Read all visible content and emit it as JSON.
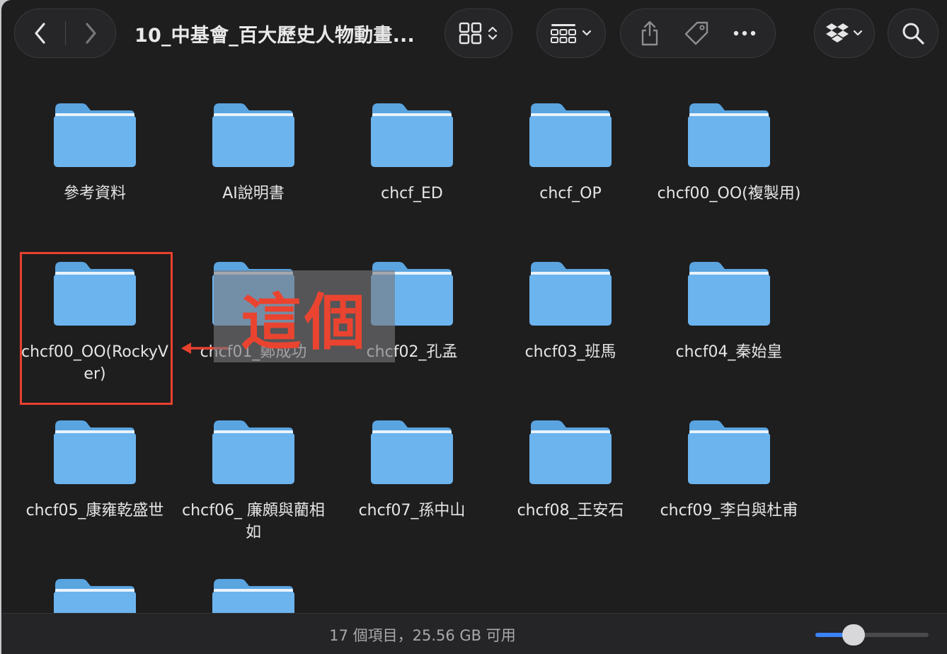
{
  "window": {
    "title": "10_中基會_百大歷史人物動畫..."
  },
  "toolbar": {
    "back_icon": "chevron-left-icon",
    "forward_icon": "chevron-right-icon",
    "view_icon": "grid-view-icon",
    "group_icon": "group-by-icon",
    "share_icon": "share-icon",
    "tag_icon": "tag-icon",
    "more_icon": "ellipsis-icon",
    "dropbox_icon": "dropbox-icon",
    "search_icon": "search-icon"
  },
  "folders": [
    {
      "name": "參考資料"
    },
    {
      "name": "AI說明書"
    },
    {
      "name": "chcf_ED"
    },
    {
      "name": "chcf_OP"
    },
    {
      "name": "chcf00_OO(複製用)"
    },
    {
      "name": "chcf00_OO(RockyVer)"
    },
    {
      "name": "chcf01_鄭成功"
    },
    {
      "name": "chcf02_孔孟"
    },
    {
      "name": "chcf03_班馬"
    },
    {
      "name": "chcf04_秦始皇"
    },
    {
      "name": "chcf05_康雍乾盛世"
    },
    {
      "name": "chcf06_ 廉頗與藺相如"
    },
    {
      "name": "chcf07_孫中山"
    },
    {
      "name": "chcf08_王安石"
    },
    {
      "name": "chcf09_李白與杜甫"
    },
    {
      "name": ""
    },
    {
      "name": ""
    }
  ],
  "annotation": {
    "text": "這個",
    "color": "#e8412e"
  },
  "statusbar": {
    "text": "17 個項目，25.56 GB 可用",
    "zoom_level": 0.3
  },
  "colors": {
    "folder": "#6cb4ee",
    "accent": "#3a82f6"
  }
}
